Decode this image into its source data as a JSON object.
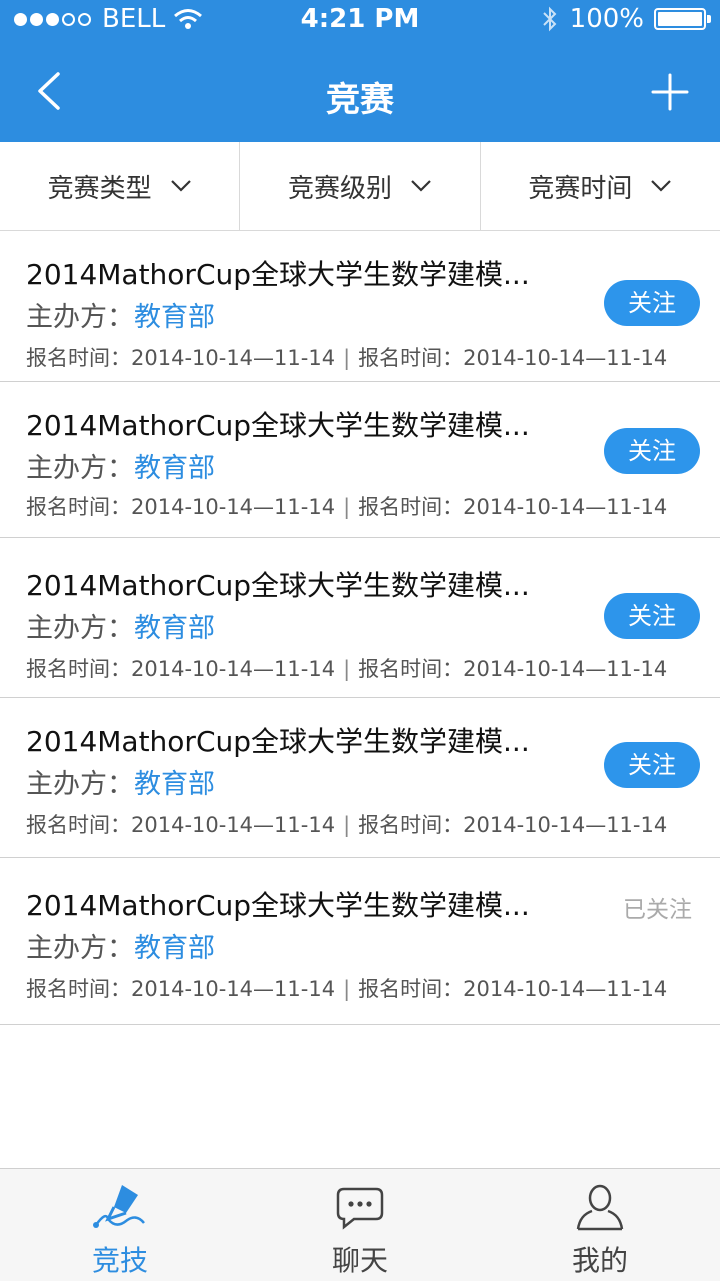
{
  "status_bar": {
    "carrier": "BELL",
    "time": "4:21 PM",
    "battery": "100%"
  },
  "nav": {
    "title": "竞赛"
  },
  "filters": [
    {
      "label": "竞赛类型"
    },
    {
      "label": "竞赛级别"
    },
    {
      "label": "竞赛时间"
    }
  ],
  "items": [
    {
      "title": "2014MathorCup全球大学生数学建模...",
      "org_label": "主办方：",
      "org": "教育部",
      "date1": "报名时间：2014-10-14—11-14",
      "date2": "报名时间：2014-10-14—11-14",
      "action": "关注",
      "followed": false
    },
    {
      "title": "2014MathorCup全球大学生数学建模...",
      "org_label": "主办方：",
      "org": "教育部",
      "date1": "报名时间：2014-10-14—11-14",
      "date2": "报名时间：2014-10-14—11-14",
      "action": "关注",
      "followed": false
    },
    {
      "title": "2014MathorCup全球大学生数学建模...",
      "org_label": "主办方：",
      "org": "教育部",
      "date1": "报名时间：2014-10-14—11-14",
      "date2": "报名时间：2014-10-14—11-14",
      "action": "关注",
      "followed": false
    },
    {
      "title": "2014MathorCup全球大学生数学建模...",
      "org_label": "主办方：",
      "org": "教育部",
      "date1": "报名时间：2014-10-14—11-14",
      "date2": "报名时间：2014-10-14—11-14",
      "action": "关注",
      "followed": false
    },
    {
      "title": "2014MathorCup全球大学生数学建模...",
      "org_label": "主办方：",
      "org": "教育部",
      "date1": "报名时间：2014-10-14—11-14",
      "date2": "报名时间：2014-10-14—11-14",
      "action": "已关注",
      "followed": true
    }
  ],
  "tabs": [
    {
      "label": "竞技",
      "icon": "pen-icon",
      "active": true
    },
    {
      "label": "聊天",
      "icon": "chat-icon",
      "active": false
    },
    {
      "label": "我的",
      "icon": "user-icon",
      "active": false
    }
  ],
  "colors": {
    "primary": "#2d8de0",
    "button": "#2d95eb",
    "followed_text": "#aaaaaa"
  }
}
